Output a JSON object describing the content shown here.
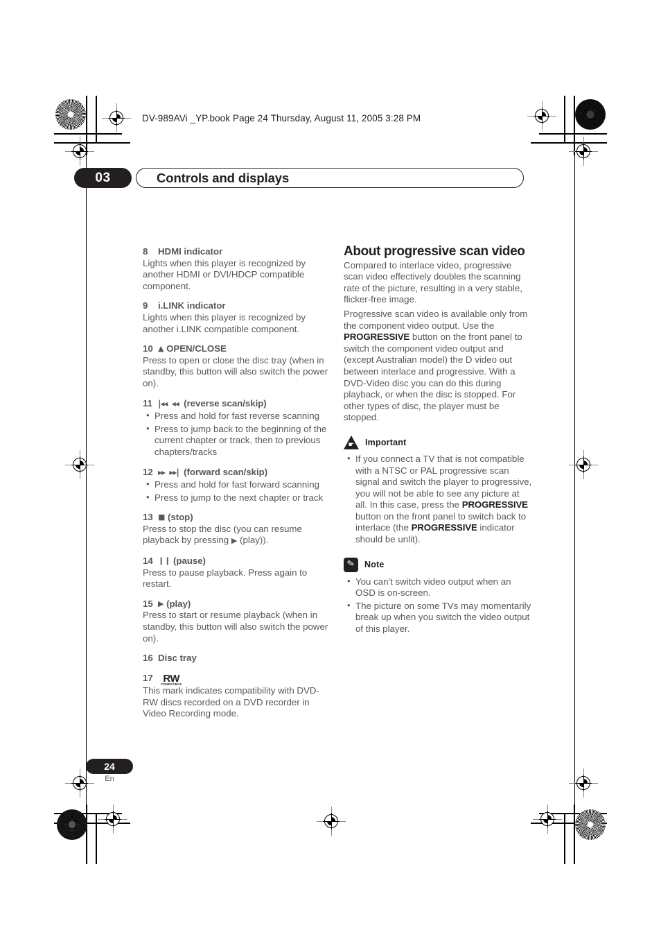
{
  "file_header": "DV-989AVi _YP.book  Page 24  Thursday, August 11, 2005  3:28 PM",
  "chapter": {
    "number": "03",
    "title": "Controls and displays"
  },
  "footer": {
    "page_number": "24",
    "language": "En"
  },
  "left_column": {
    "items": [
      {
        "num": "8",
        "title": "HDMI indicator",
        "symbol": "",
        "body": "Lights when this player is recognized by another HDMI or DVI/HDCP compatible component."
      },
      {
        "num": "9",
        "title": "i.LINK indicator",
        "symbol": "",
        "body": "Lights when this player is recognized by another i.LINK compatible component."
      },
      {
        "num": "10",
        "title": "OPEN/CLOSE",
        "symbol": "▲",
        "body": "Press to open or close the disc tray (when in standby, this button will also switch the power on)."
      },
      {
        "num": "11",
        "title": "(reverse scan/skip)",
        "symbol": "◂◂  ◂◂",
        "bullets": [
          "Press and hold for fast reverse scanning",
          "Press to jump back to the beginning of the current chapter or track, then to previous chapters/tracks"
        ]
      },
      {
        "num": "12",
        "title": "(forward scan/skip)",
        "symbol": "▸▸  ▸▸",
        "bullets": [
          "Press and hold for fast forward scanning",
          "Press to jump to the next chapter or track"
        ]
      },
      {
        "num": "13",
        "title": "(stop)",
        "symbol": "■",
        "body_pre": "Press to stop the disc (you can resume playback by pressing ",
        "body_sym": "▶",
        "body_post": " (play))."
      },
      {
        "num": "14",
        "title": "(pause)",
        "symbol": "❙❙",
        "body": "Press to pause playback. Press again to restart."
      },
      {
        "num": "15",
        "title": "(play)",
        "symbol": "▶",
        "body": "Press to start or resume playback (when in standby, this button will also switch the power on)."
      },
      {
        "num": "16",
        "title": "Disc tray",
        "symbol": "",
        "body": ""
      },
      {
        "num": "17",
        "title": "",
        "logo_main": "RW",
        "logo_sub": "COMPATIBLE",
        "body": "This mark indicates compatibility with DVD-RW discs recorded on a DVD recorder in Video Recording mode."
      }
    ]
  },
  "right_column": {
    "heading": "About progressive scan video",
    "para1": "Compared to interlace video, progressive scan video effectively doubles the scanning rate of the picture, resulting in a very stable, flicker-free image.",
    "para2_a": "Progressive scan video is available only from the component video output. Use the ",
    "para2_kw": "PROGRESSIVE",
    "para2_b": " button on the front panel to switch the component video output and (except Australian model) the D video out between interlace and progressive. With a DVD-Video disc you can do this during playback, or when the disc is stopped. For other types of disc, the player must be stopped.",
    "important": {
      "icon": "warning-triangle-icon",
      "label": "Important",
      "bullet_a": "If you connect a TV that is not compatible with a NTSC or PAL progressive scan signal and switch the player to progressive, you will not be able to see any picture at all. In this case, press the ",
      "bullet_kw1": "PROGRESSIVE",
      "bullet_b": " button on the front panel to switch back to interlace (the ",
      "bullet_kw2": "PROGRESSIVE",
      "bullet_c": " indicator should be unlit)."
    },
    "note": {
      "icon": "pencil-icon",
      "label": "Note",
      "bullets": [
        "You can't switch video output when an OSD is on-screen.",
        "The picture on some TVs may momentarily break up when you switch the video output of this player."
      ]
    }
  }
}
